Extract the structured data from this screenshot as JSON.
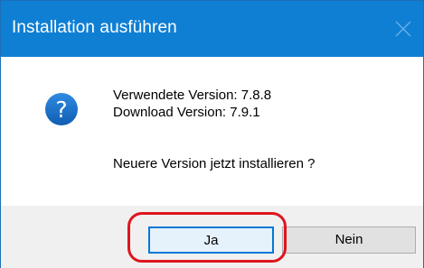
{
  "window": {
    "title": "Installation ausführen",
    "close_icon": "close-icon"
  },
  "message": {
    "icon": "question-icon",
    "used_version": "Verwendete Version: 7.8.8",
    "download_version": "Download Version: 7.9.1",
    "question": "Neuere Version jetzt installieren ?"
  },
  "buttons": {
    "yes_label": "Ja",
    "no_label": "Nein"
  },
  "colors": {
    "titlebar": "#0f7fd4",
    "highlight": "#e0141e",
    "icon": "#1a6ec4"
  }
}
